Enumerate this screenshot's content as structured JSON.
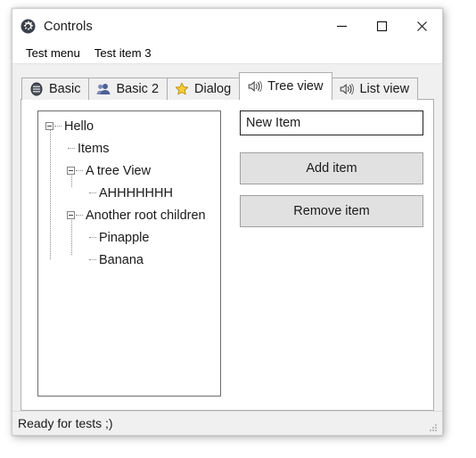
{
  "window": {
    "title": "Controls",
    "icon": "gear-icon",
    "buttons": {
      "minimize": "minimize-icon",
      "maximize": "maximize-icon",
      "close": "close-icon"
    }
  },
  "menubar": {
    "items": [
      {
        "label": "Test menu"
      },
      {
        "label": "Test item 3"
      }
    ]
  },
  "tabs": [
    {
      "label": "Basic",
      "icon": "list-ellipse-icon",
      "active": false
    },
    {
      "label": "Basic 2",
      "icon": "users-icon",
      "active": false
    },
    {
      "label": "Dialog",
      "icon": "star-icon",
      "active": false
    },
    {
      "label": "Tree view",
      "icon": "speaker-icon",
      "active": true
    },
    {
      "label": "List view",
      "icon": "speaker-icon",
      "active": false
    }
  ],
  "treeview": {
    "nodes": [
      {
        "label": "Hello",
        "depth": 0,
        "expander": true
      },
      {
        "label": "Items",
        "depth": 1,
        "expander": false
      },
      {
        "label": "A tree View",
        "depth": 1,
        "expander": true
      },
      {
        "label": "AHHHHHHH",
        "depth": 2,
        "expander": false
      },
      {
        "label": "Another root children",
        "depth": 1,
        "expander": true
      },
      {
        "label": "Pinapple",
        "depth": 2,
        "expander": false
      },
      {
        "label": "Banana",
        "depth": 2,
        "expander": false
      }
    ]
  },
  "controls": {
    "new_item_value": "New Item",
    "new_item_placeholder": "New Item",
    "add_button": "Add item",
    "remove_button": "Remove item"
  },
  "statusbar": {
    "text": "Ready for tests ;)",
    "grip": "resize-grip-icon"
  },
  "colors": {
    "window_bg": "#f0f0f0",
    "panel_bg": "#ffffff",
    "tab_border": "#aeaeae",
    "button_bg": "#e1e1e1",
    "star_icon": "#f2c233",
    "users_icon": "#5c6fa8",
    "tree_border": "#6d6d6d"
  }
}
